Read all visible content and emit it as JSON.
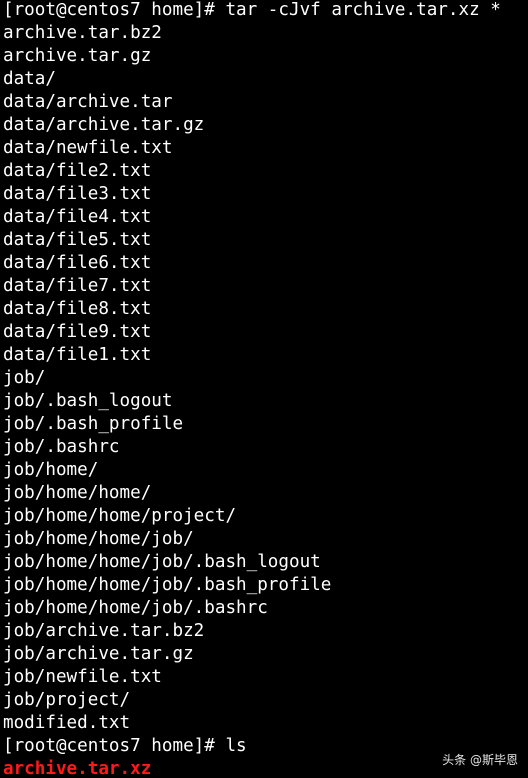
{
  "terminal": {
    "lines": [
      "[root@centos7 home]# tar -cJvf archive.tar.xz *",
      "archive.tar.bz2",
      "archive.tar.gz",
      "data/",
      "data/archive.tar",
      "data/archive.tar.gz",
      "data/newfile.txt",
      "data/file2.txt",
      "data/file3.txt",
      "data/file4.txt",
      "data/file5.txt",
      "data/file6.txt",
      "data/file7.txt",
      "data/file8.txt",
      "data/file9.txt",
      "data/file1.txt",
      "job/",
      "job/.bash_logout",
      "job/.bash_profile",
      "job/.bashrc",
      "job/home/",
      "job/home/home/",
      "job/home/home/project/",
      "job/home/home/job/",
      "job/home/home/job/.bash_logout",
      "job/home/home/job/.bash_profile",
      "job/home/home/job/.bashrc",
      "job/archive.tar.bz2",
      "job/archive.tar.gz",
      "job/newfile.txt",
      "job/project/",
      "modified.txt",
      "[root@centos7 home]# ls",
      "archive.tar.xz"
    ],
    "colors": {
      "background": "#000000",
      "text": "#ffffff",
      "archive_highlight": "#ff1a1a"
    }
  },
  "watermark": {
    "text": "头条 @斯毕恩"
  }
}
